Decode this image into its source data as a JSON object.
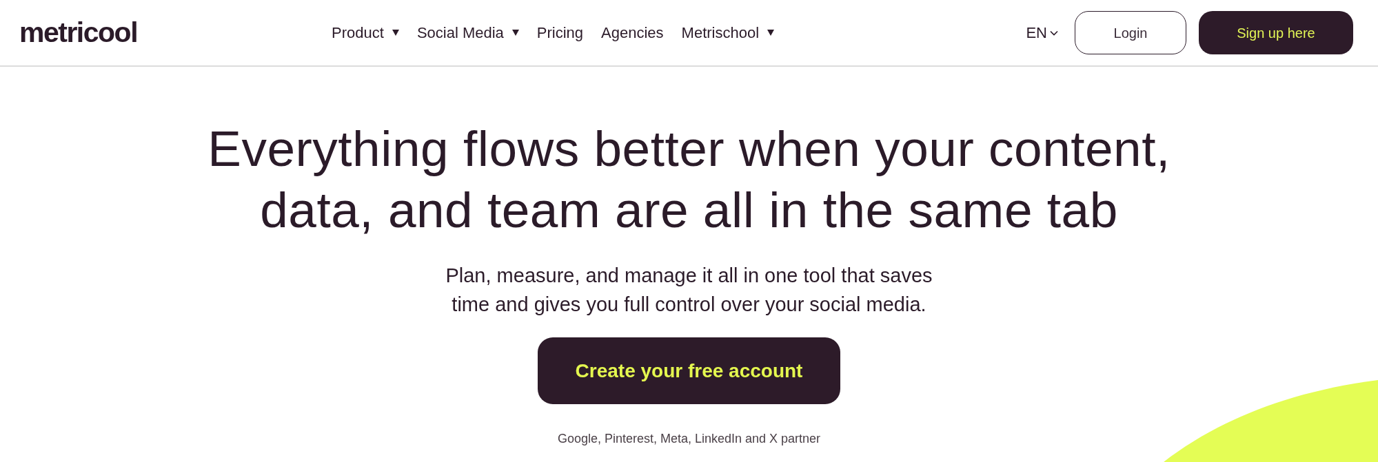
{
  "header": {
    "logo": "metricool",
    "nav": [
      {
        "label": "Product",
        "dropdown": true
      },
      {
        "label": "Social Media",
        "dropdown": true
      },
      {
        "label": "Pricing",
        "dropdown": false
      },
      {
        "label": "Agencies",
        "dropdown": false
      },
      {
        "label": "Metrischool",
        "dropdown": true
      }
    ],
    "language": "EN",
    "login": "Login",
    "signup": "Sign up here"
  },
  "hero": {
    "headline": [
      "Everything flows better when your content,",
      "data, and team are all in the same tab"
    ],
    "subtitle": [
      "Plan, measure, and manage it all in one tool that saves",
      "time and gives you full control over your social media."
    ],
    "cta": "Create your free account",
    "partner_note": "Google, Pinterest, Meta, LinkedIn and X partner"
  }
}
